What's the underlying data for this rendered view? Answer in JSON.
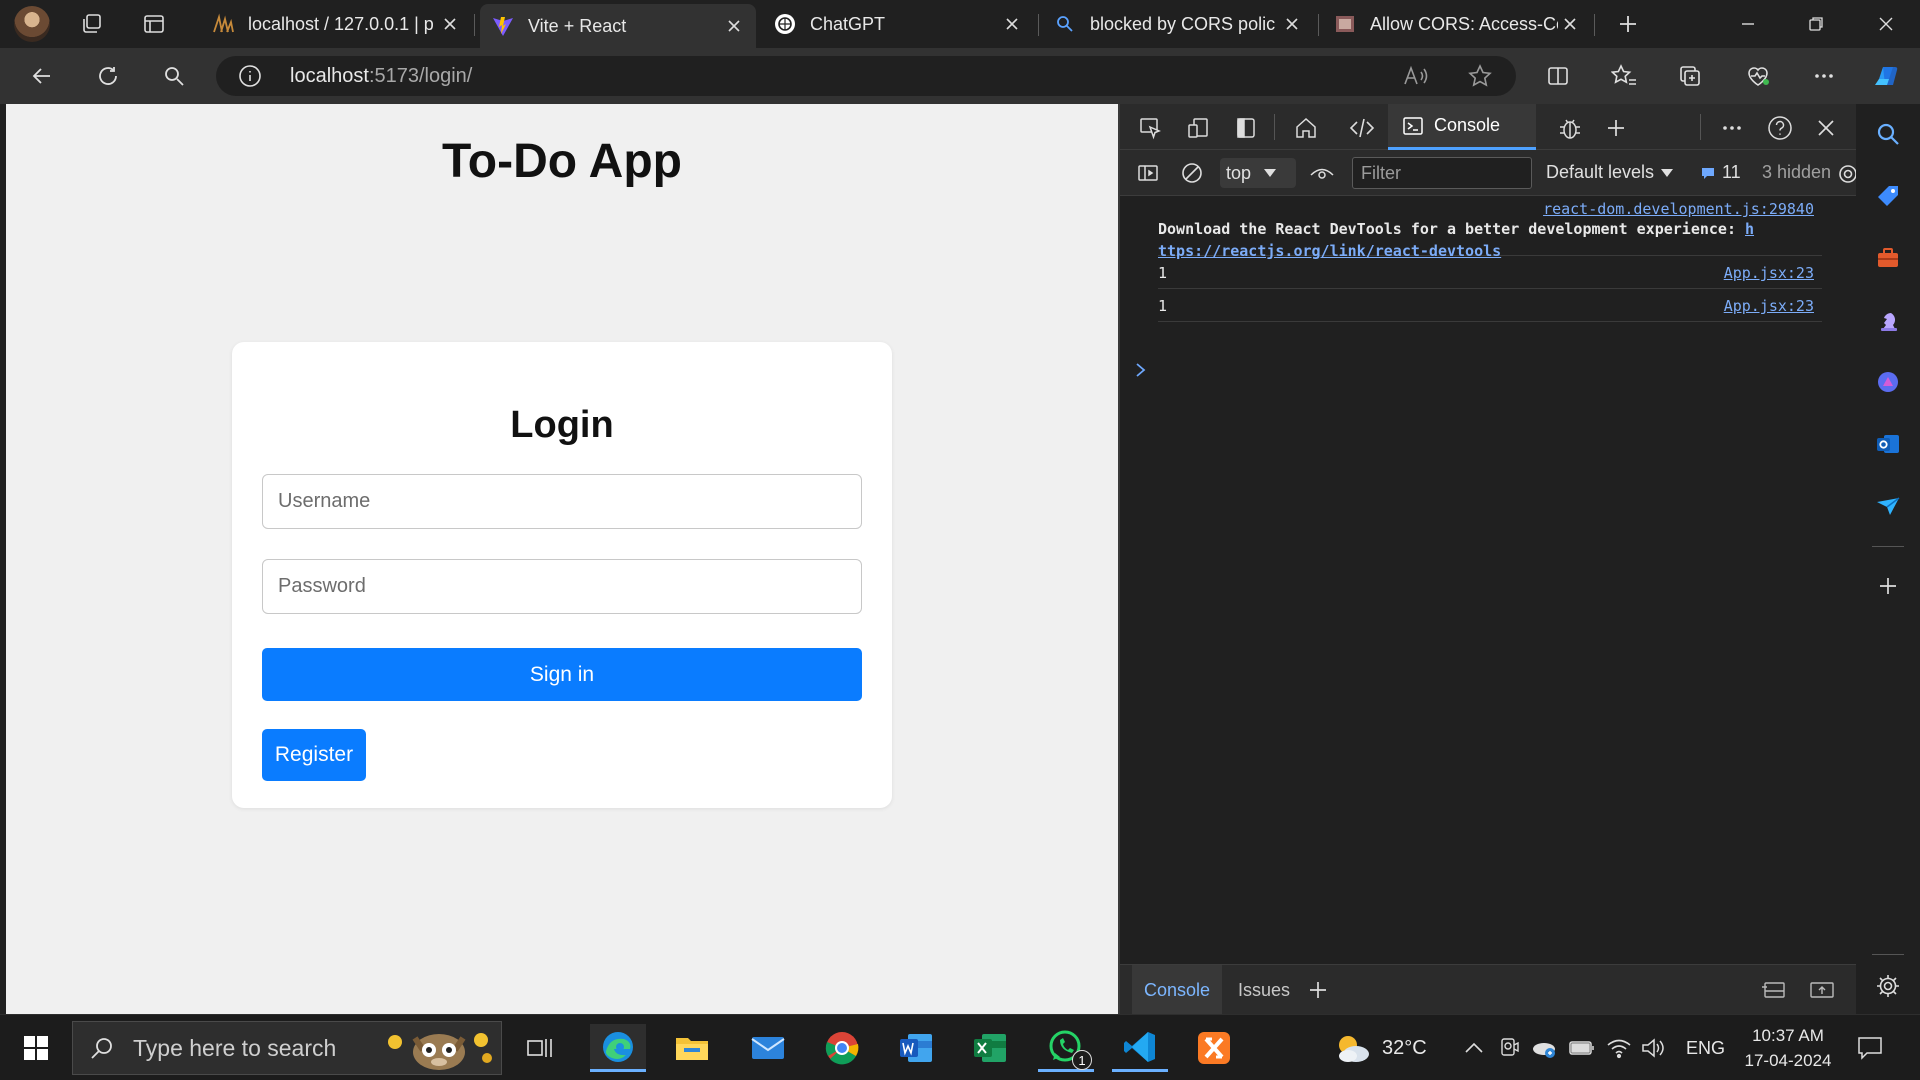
{
  "browser": {
    "tabs": [
      {
        "title": "localhost / 127.0.0.1 | p"
      },
      {
        "title": "Vite + React"
      },
      {
        "title": "ChatGPT"
      },
      {
        "title": "blocked by CORS polic"
      },
      {
        "title": "Allow CORS: Access-Co"
      }
    ],
    "url_host": "localhost",
    "url_path": ":5173/login/"
  },
  "page": {
    "heading": "To-Do App",
    "card_title": "Login",
    "username_placeholder": "Username",
    "password_placeholder": "Password",
    "signin_label": "Sign in",
    "register_label": "Register"
  },
  "devtools": {
    "console_tab": "Console",
    "context": "top",
    "filter_placeholder": "Filter",
    "levels": "Default levels",
    "message_count": "11",
    "hidden": "3 hidden",
    "messages": [
      {
        "source": "react-dom.development.js:29840",
        "text": "Download the React DevTools for a better development experience: ",
        "link_a": "h",
        "link_b": "ttps://reactjs.org/link/react-devtools"
      },
      {
        "value": "1",
        "source": "App.jsx:23"
      },
      {
        "value": "1",
        "source": "App.jsx:23"
      }
    ],
    "drawer_tabs": [
      "Console",
      "Issues"
    ]
  },
  "taskbar": {
    "search_placeholder": "Type here to search",
    "temperature": "32°C",
    "language": "ENG",
    "time": "10:37 AM",
    "date": "17-04-2024",
    "whatsapp_badge": "1"
  },
  "colors": {
    "accent": "#0a7cff",
    "devtools_link": "#7cacf8",
    "page_bg": "#f0f0f0"
  }
}
